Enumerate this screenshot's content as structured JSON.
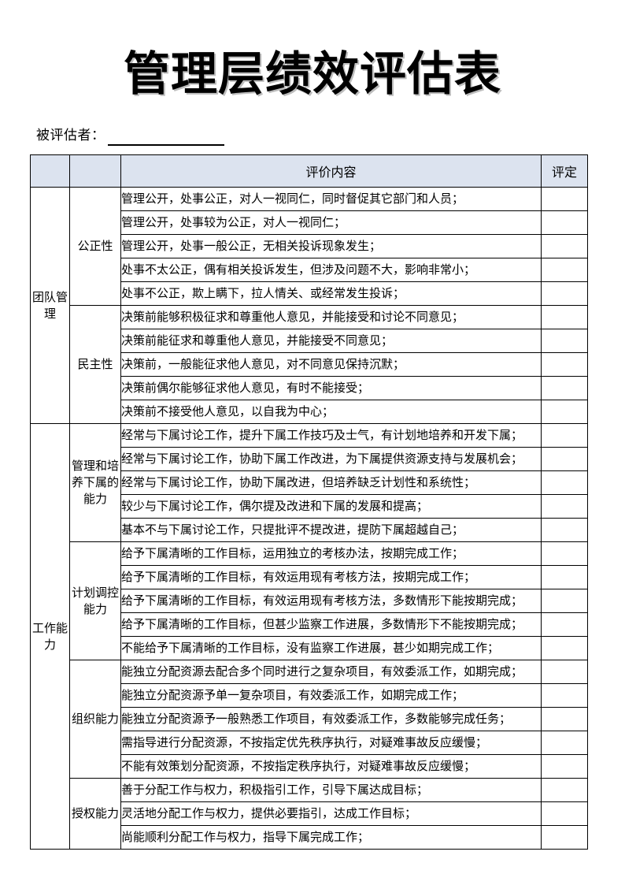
{
  "document": {
    "title": "管理层绩效评估表",
    "subject_label": "被评估者：",
    "subject_value": ""
  },
  "table": {
    "headers": {
      "category": "",
      "subcategory": "",
      "content": "评价内容",
      "score": "评定"
    },
    "sections": [
      {
        "category": "团队管理",
        "groups": [
          {
            "subcategory": "公正性",
            "rows": [
              "管理公开，处事公正，对人一视同仁，同时督促其它部门和人员；",
              "管理公开，处事较为公正，对人一视同仁；",
              "管理公开，处事一般公正，无相关投诉现象发生；",
              "处事不太公正，偶有相关投诉发生，但涉及问题不大，影响非常小；",
              "处事不公正，欺上瞒下，拉人情关、或经常发生投诉；"
            ]
          },
          {
            "subcategory": "民主性",
            "rows": [
              "决策前能够积极征求和尊重他人意见，并能接受和讨论不同意见；",
              "决策前能征求和尊重他人意见，并能接受不同意见；",
              "决策前，一般能征求他人意见，对不同意见保持沉默；",
              "决策前偶尔能够征求他人意见，有时不能接受；",
              "决策前不接受他人意见，以自我为中心；"
            ]
          }
        ]
      },
      {
        "category": "工作能力",
        "groups": [
          {
            "subcategory": "管理和培养下属的能力",
            "rows": [
              "经常与下属讨论工作，提升下属工作技巧及士气，有计划地培养和开发下属；",
              "经常与下属讨论工作，协助下属工作改进，为下属提供资源支持与发展机会；",
              "经常与下属讨论工作，协助下属改进，但培养缺乏计划性和系统性；",
              "较少与下属讨论工作，偶尔提及改进和下属的发展和提高；",
              "基本不与下属讨论工作，只提批评不提改进，提防下属超越自己；"
            ]
          },
          {
            "subcategory": "计划调控能力",
            "rows": [
              "给予下属清晰的工作目标，运用独立的考核办法，按期完成工作；",
              "给予下属清晰的工作目标，有效运用现有考核方法，按期完成工作；",
              "给予下属清晰的工作目标，有效运用现有考核方法，多数情形下能按期完成；",
              "给予下属清晰的工作目标，但甚少监察工作进展，多数情形下不能按期完成；",
              "不能给予下属清晰的工作目标，没有监察工作进展，甚少如期完成工作；"
            ]
          },
          {
            "subcategory": "组织能力",
            "rows": [
              "能独立分配资源去配合多个同时进行之复杂项目，有效委派工作，如期完成；",
              "能独立分配资源予单一复杂项目，有效委派工作，如期完成工作；",
              "能独立分配资源予一般熟悉工作项目，有效委派工作，多数能够完成任务；",
              "需指导进行分配资源，不按指定优先秩序执行，对疑难事故反应缓慢；",
              "不能有效策划分配资源，不按指定秩序执行，对疑难事故反应缓慢；"
            ]
          },
          {
            "subcategory": "授权能力",
            "rows": [
              "善于分配工作与权力，积极指引工作，引导下属达成目标；",
              "灵活地分配工作与权力，提供必要指引，达成工作目标；",
              "尚能顺利分配工作与权力，指导下属完成工作；"
            ]
          }
        ]
      }
    ]
  },
  "colors": {
    "header_background": "#dce3ef",
    "border": "#000000",
    "title_shadow": "#bdbdbd"
  }
}
